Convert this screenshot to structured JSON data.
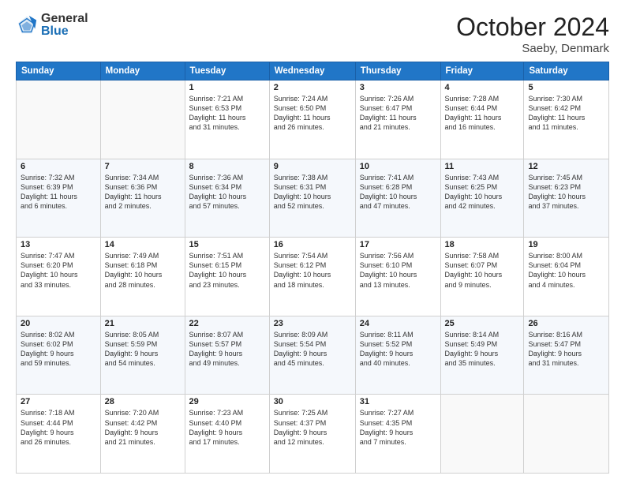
{
  "header": {
    "logo_general": "General",
    "logo_blue": "Blue",
    "month": "October 2024",
    "location": "Saeby, Denmark"
  },
  "weekdays": [
    "Sunday",
    "Monday",
    "Tuesday",
    "Wednesday",
    "Thursday",
    "Friday",
    "Saturday"
  ],
  "weeks": [
    [
      {
        "day": "",
        "text": ""
      },
      {
        "day": "",
        "text": ""
      },
      {
        "day": "1",
        "text": "Sunrise: 7:21 AM\nSunset: 6:53 PM\nDaylight: 11 hours\nand 31 minutes."
      },
      {
        "day": "2",
        "text": "Sunrise: 7:24 AM\nSunset: 6:50 PM\nDaylight: 11 hours\nand 26 minutes."
      },
      {
        "day": "3",
        "text": "Sunrise: 7:26 AM\nSunset: 6:47 PM\nDaylight: 11 hours\nand 21 minutes."
      },
      {
        "day": "4",
        "text": "Sunrise: 7:28 AM\nSunset: 6:44 PM\nDaylight: 11 hours\nand 16 minutes."
      },
      {
        "day": "5",
        "text": "Sunrise: 7:30 AM\nSunset: 6:42 PM\nDaylight: 11 hours\nand 11 minutes."
      }
    ],
    [
      {
        "day": "6",
        "text": "Sunrise: 7:32 AM\nSunset: 6:39 PM\nDaylight: 11 hours\nand 6 minutes."
      },
      {
        "day": "7",
        "text": "Sunrise: 7:34 AM\nSunset: 6:36 PM\nDaylight: 11 hours\nand 2 minutes."
      },
      {
        "day": "8",
        "text": "Sunrise: 7:36 AM\nSunset: 6:34 PM\nDaylight: 10 hours\nand 57 minutes."
      },
      {
        "day": "9",
        "text": "Sunrise: 7:38 AM\nSunset: 6:31 PM\nDaylight: 10 hours\nand 52 minutes."
      },
      {
        "day": "10",
        "text": "Sunrise: 7:41 AM\nSunset: 6:28 PM\nDaylight: 10 hours\nand 47 minutes."
      },
      {
        "day": "11",
        "text": "Sunrise: 7:43 AM\nSunset: 6:25 PM\nDaylight: 10 hours\nand 42 minutes."
      },
      {
        "day": "12",
        "text": "Sunrise: 7:45 AM\nSunset: 6:23 PM\nDaylight: 10 hours\nand 37 minutes."
      }
    ],
    [
      {
        "day": "13",
        "text": "Sunrise: 7:47 AM\nSunset: 6:20 PM\nDaylight: 10 hours\nand 33 minutes."
      },
      {
        "day": "14",
        "text": "Sunrise: 7:49 AM\nSunset: 6:18 PM\nDaylight: 10 hours\nand 28 minutes."
      },
      {
        "day": "15",
        "text": "Sunrise: 7:51 AM\nSunset: 6:15 PM\nDaylight: 10 hours\nand 23 minutes."
      },
      {
        "day": "16",
        "text": "Sunrise: 7:54 AM\nSunset: 6:12 PM\nDaylight: 10 hours\nand 18 minutes."
      },
      {
        "day": "17",
        "text": "Sunrise: 7:56 AM\nSunset: 6:10 PM\nDaylight: 10 hours\nand 13 minutes."
      },
      {
        "day": "18",
        "text": "Sunrise: 7:58 AM\nSunset: 6:07 PM\nDaylight: 10 hours\nand 9 minutes."
      },
      {
        "day": "19",
        "text": "Sunrise: 8:00 AM\nSunset: 6:04 PM\nDaylight: 10 hours\nand 4 minutes."
      }
    ],
    [
      {
        "day": "20",
        "text": "Sunrise: 8:02 AM\nSunset: 6:02 PM\nDaylight: 9 hours\nand 59 minutes."
      },
      {
        "day": "21",
        "text": "Sunrise: 8:05 AM\nSunset: 5:59 PM\nDaylight: 9 hours\nand 54 minutes."
      },
      {
        "day": "22",
        "text": "Sunrise: 8:07 AM\nSunset: 5:57 PM\nDaylight: 9 hours\nand 49 minutes."
      },
      {
        "day": "23",
        "text": "Sunrise: 8:09 AM\nSunset: 5:54 PM\nDaylight: 9 hours\nand 45 minutes."
      },
      {
        "day": "24",
        "text": "Sunrise: 8:11 AM\nSunset: 5:52 PM\nDaylight: 9 hours\nand 40 minutes."
      },
      {
        "day": "25",
        "text": "Sunrise: 8:14 AM\nSunset: 5:49 PM\nDaylight: 9 hours\nand 35 minutes."
      },
      {
        "day": "26",
        "text": "Sunrise: 8:16 AM\nSunset: 5:47 PM\nDaylight: 9 hours\nand 31 minutes."
      }
    ],
    [
      {
        "day": "27",
        "text": "Sunrise: 7:18 AM\nSunset: 4:44 PM\nDaylight: 9 hours\nand 26 minutes."
      },
      {
        "day": "28",
        "text": "Sunrise: 7:20 AM\nSunset: 4:42 PM\nDaylight: 9 hours\nand 21 minutes."
      },
      {
        "day": "29",
        "text": "Sunrise: 7:23 AM\nSunset: 4:40 PM\nDaylight: 9 hours\nand 17 minutes."
      },
      {
        "day": "30",
        "text": "Sunrise: 7:25 AM\nSunset: 4:37 PM\nDaylight: 9 hours\nand 12 minutes."
      },
      {
        "day": "31",
        "text": "Sunrise: 7:27 AM\nSunset: 4:35 PM\nDaylight: 9 hours\nand 7 minutes."
      },
      {
        "day": "",
        "text": ""
      },
      {
        "day": "",
        "text": ""
      }
    ]
  ]
}
